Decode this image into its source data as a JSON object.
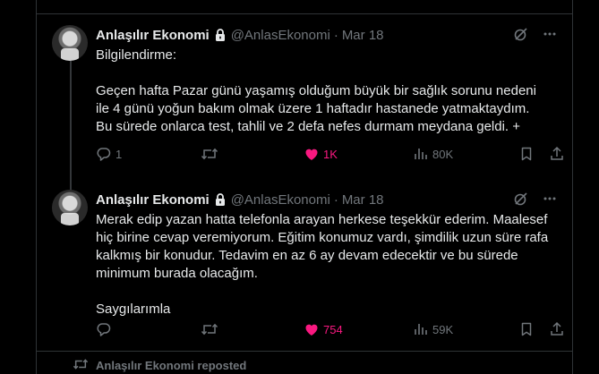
{
  "tweets": [
    {
      "author_name": "Anlaşılır Ekonomi",
      "handle": "@AnlasEkonomi",
      "separator": "·",
      "date": "Mar 18",
      "text": "Bilgilendirme:\n\nGeçen hafta Pazar günü yaşamış olduğum büyük bir sağlık sorunu nedeni ile 4 günü yoğun bakım olmak üzere 1 haftadır hastanede yatmaktaydım. Bu sürede onlarca test, tahlil ve 2 defa nefes durmam meydana geldi. +",
      "replies": "1",
      "reposts": "",
      "likes": "1K",
      "views": "80K",
      "liked": true
    },
    {
      "author_name": "Anlaşılır Ekonomi",
      "handle": "@AnlasEkonomi",
      "separator": "·",
      "date": "Mar 18",
      "text": "Merak edip yazan hatta telefonla arayan herkese teşekkür ederim. Maalesef hiç birine cevap veremiyorum. Eğitim konumuz vardı, şimdilik uzun süre rafa kalkmış bir konudur. Tedavim en az 6 ay devam edecektir ve bu sürede minimum burada olacağım.\n\nSaygılarımla",
      "replies": "",
      "reposts": "",
      "likes": "754",
      "views": "59K",
      "liked": true
    }
  ],
  "repost_notice": "Anlaşılır Ekonomi reposted",
  "colors": {
    "background": "#000000",
    "text": "#e7e9ea",
    "muted": "#71767b",
    "like": "#f91880",
    "border": "#2f3336"
  },
  "icons": {
    "lock": "lock-icon",
    "grok": "grok-icon",
    "more": "more-icon",
    "reply": "reply-icon",
    "repost": "repost-icon",
    "like": "heart-filled-icon",
    "views": "views-icon",
    "bookmark": "bookmark-icon",
    "share": "share-icon"
  }
}
